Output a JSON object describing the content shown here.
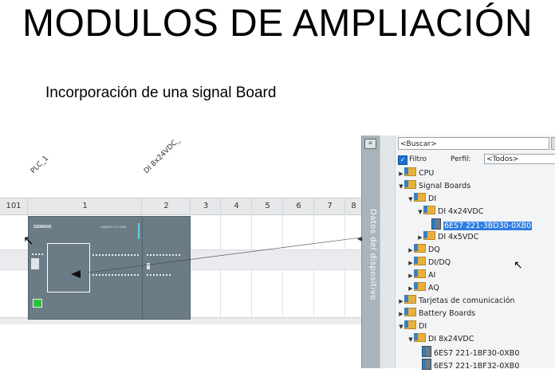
{
  "slide": {
    "title": "MODULOS DE AMPLIACIÓN",
    "subtitle": "Incorporación de una signal Board"
  },
  "device_view": {
    "device_labels": [
      "PLC_1",
      "DI 8x24VDC_"
    ],
    "slot_numbers": [
      "101",
      "1",
      "2",
      "3",
      "4",
      "5",
      "6",
      "7",
      "8"
    ],
    "plc_brand": "SIEMENS",
    "plc_model": "SIMATIC S7-1200"
  },
  "tab_strip": {
    "label": "Datos del dispositivo"
  },
  "catalog": {
    "search_placeholder": "<Buscar>",
    "filter_label": "Filtro",
    "filter_checked": true,
    "profile_label": "Perfil:",
    "profile_value": "<Todos>",
    "tree": [
      {
        "label": "CPU",
        "expanded": false,
        "level": 0,
        "type": "folder"
      },
      {
        "label": "Signal Boards",
        "expanded": true,
        "level": 0,
        "type": "folder"
      },
      {
        "label": "DI",
        "expanded": true,
        "level": 1,
        "type": "folder"
      },
      {
        "label": "DI 4x24VDC",
        "expanded": true,
        "level": 2,
        "type": "folder"
      },
      {
        "label": "6ES7 221-3BD30-0XB0",
        "level": 3,
        "type": "module",
        "selected": true
      },
      {
        "label": "DI 4x5VDC",
        "expanded": false,
        "level": 2,
        "type": "folder"
      },
      {
        "label": "DQ",
        "expanded": false,
        "level": 1,
        "type": "folder"
      },
      {
        "label": "DI/DQ",
        "expanded": false,
        "level": 1,
        "type": "folder"
      },
      {
        "label": "AI",
        "expanded": false,
        "level": 1,
        "type": "folder"
      },
      {
        "label": "AQ",
        "expanded": false,
        "level": 1,
        "type": "folder"
      },
      {
        "label": "Tarjetas de comunicación",
        "expanded": false,
        "level": 0,
        "type": "folder"
      },
      {
        "label": "Battery Boards",
        "expanded": false,
        "level": 0,
        "type": "folder"
      },
      {
        "label": "DI",
        "expanded": true,
        "level": 0,
        "type": "folder"
      },
      {
        "label": "DI 8x24VDC",
        "expanded": true,
        "level": 1,
        "type": "folder"
      },
      {
        "label": "6ES7 221-1BF30-0XB0",
        "level": 2,
        "type": "module"
      },
      {
        "label": "6ES7 221-1BF32-0XB0",
        "level": 2,
        "type": "module"
      }
    ]
  },
  "colors": {
    "module_body": "#6b7c86",
    "selection": "#2f7de1",
    "status_led": "#2dbf3c"
  }
}
